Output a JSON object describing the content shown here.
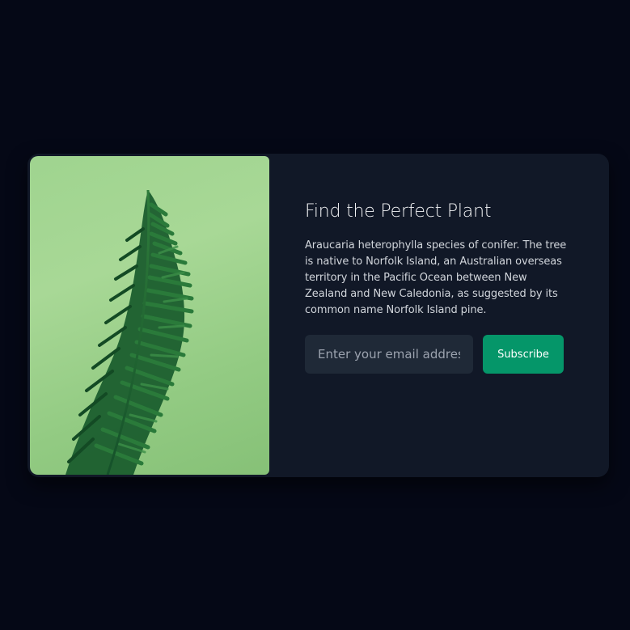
{
  "newsletter": {
    "title": "Find the Perfect Plant",
    "description": "Araucaria heterophylla species of conifer. The tree is native to Norfolk Island, an Australian overseas territory in the Pacific Ocean between New Zealand and New Caledonia, as suggested by its common name Norfolk Island pine.",
    "email_placeholder": "Enter your email address",
    "subscribe_label": "Subscribe"
  },
  "colors": {
    "page_background": "#050816",
    "card_background": "#111827",
    "input_background": "#1f2937",
    "accent": "#059669",
    "photo_background": "#a8d896",
    "foliage": "#1f6b34"
  }
}
